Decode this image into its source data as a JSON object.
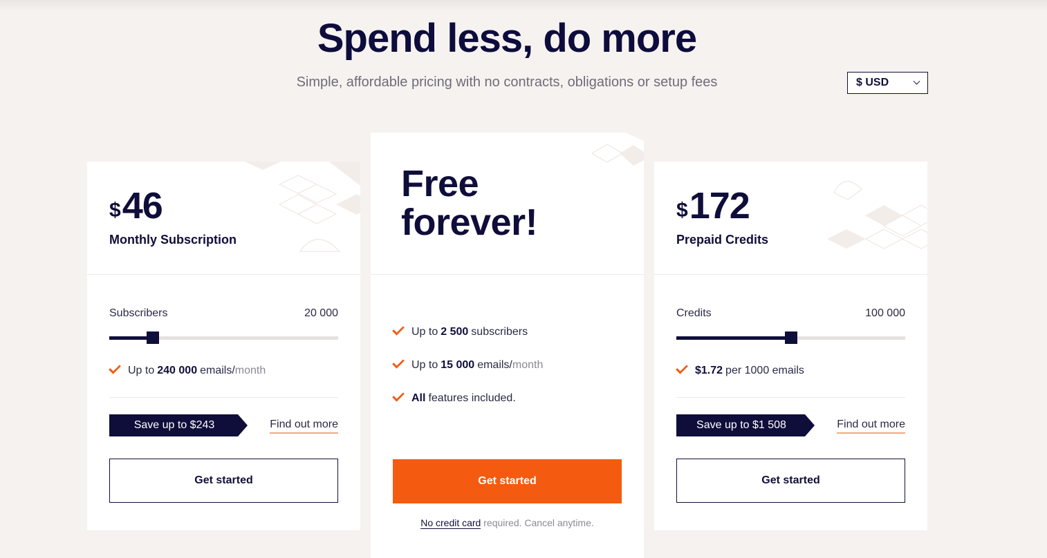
{
  "header": {
    "title": "Spend less, do more",
    "subtitle": "Simple, affordable pricing with no contracts, obligations or setup fees",
    "currency_selected": "$ USD"
  },
  "plans": {
    "subscription": {
      "currency_symbol": "$",
      "price": "46",
      "name": "Monthly Subscription",
      "slider_label": "Subscribers",
      "slider_value": "20 000",
      "slider_fraction": 0.19,
      "feature_prefix": "Up to",
      "feature_bold": "240 000",
      "feature_text": "emails/",
      "feature_muted": "month",
      "save_label": "Save up to $243",
      "find_more": "Find out more",
      "cta": "Get started"
    },
    "free": {
      "title_line1": "Free",
      "title_line2": "forever!",
      "features": [
        {
          "prefix": "Up to",
          "bold": "2 500",
          "text": "subscribers",
          "muted": ""
        },
        {
          "prefix": "Up to",
          "bold": "15 000",
          "text": "emails/",
          "muted": "month"
        },
        {
          "prefix": "",
          "bold": "All",
          "text": "features included.",
          "muted": ""
        }
      ],
      "cta": "Get started",
      "note_link": "No credit card",
      "note_text": "required. Cancel anytime."
    },
    "credits": {
      "currency_symbol": "$",
      "price": "172",
      "name": "Prepaid Credits",
      "slider_label": "Credits",
      "slider_value": "100 000",
      "slider_fraction": 0.503,
      "feature_bold": "$1.72",
      "feature_text": "per 1000 emails",
      "save_label": "Save up to $1 508",
      "find_more": "Find out more",
      "cta": "Get started"
    }
  },
  "colors": {
    "navy": "#0f0e3a",
    "accent_orange": "#f45a10",
    "background": "#f6f2ef"
  },
  "icons": [
    "check-icon",
    "chevron-down-icon"
  ]
}
